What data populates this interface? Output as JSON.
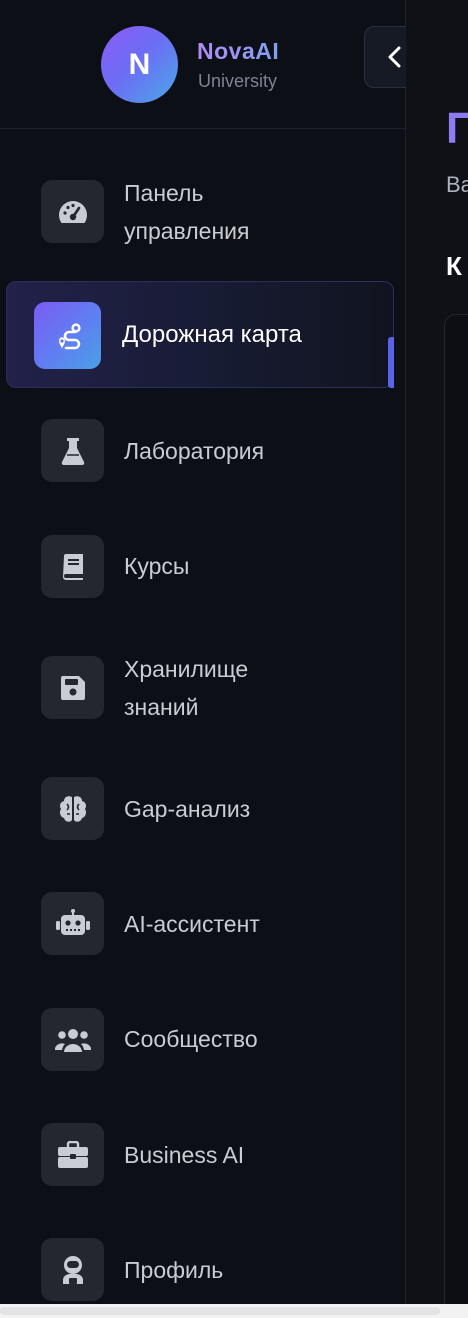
{
  "brand": {
    "avatar_letter": "N",
    "name": "NovaAI",
    "subtitle": "University"
  },
  "collapse_button": {
    "icon": "chevron-left-icon"
  },
  "nav": [
    {
      "label": "Панель управления",
      "icon": "gauge-icon",
      "active": false
    },
    {
      "label": "Дорожная карта",
      "icon": "route-icon",
      "active": true
    },
    {
      "label": "Лаборатория",
      "icon": "flask-icon",
      "active": false
    },
    {
      "label": "Курсы",
      "icon": "book-icon",
      "active": false
    },
    {
      "label": "Хранилище знаний",
      "icon": "floppy-disk-icon",
      "active": false
    },
    {
      "label": "Gap-анализ",
      "icon": "brain-icon",
      "active": false
    },
    {
      "label": "AI-ассистент",
      "icon": "robot-icon",
      "active": false
    },
    {
      "label": "Сообщество",
      "icon": "users-icon",
      "active": false
    },
    {
      "label": "Business AI",
      "icon": "briefcase-icon",
      "active": false
    },
    {
      "label": "Профиль",
      "icon": "user-astronaut-icon",
      "active": false
    }
  ],
  "main": {
    "title": "П",
    "subtitle": "Ва",
    "section": "К"
  },
  "colors": {
    "accent": "#7b5cf3",
    "background": "#0f1117",
    "sidebar": "#0d0f16",
    "icon_tile": "#24272f",
    "text": "#c9ccd3"
  }
}
